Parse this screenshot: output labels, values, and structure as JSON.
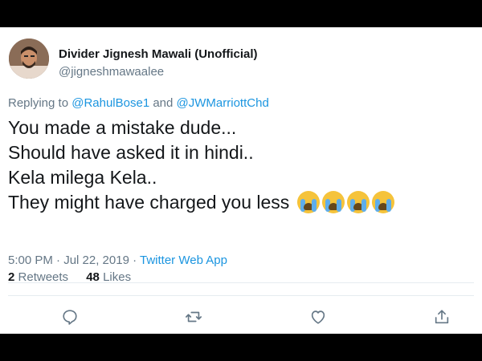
{
  "tweet": {
    "display_name": "Divider Jignesh Mawali (Unofficial)",
    "handle": "@jigneshmawaalee",
    "replying_prefix": "Replying to",
    "reply_to_1": "@RahulBose1",
    "reply_and": "and",
    "reply_to_2": "@JWMarriottChd",
    "lines": [
      "You made a mistake dude...",
      "Should have asked it in hindi..",
      "Kela milega Kela..",
      "They might have charged you less"
    ],
    "emoji_name": "loudly-crying-face",
    "emoji_count": 4,
    "timestamp": "5:00 PM · Jul 22, 2019 ·",
    "source": "Twitter Web App",
    "retweets_count": "2",
    "retweets_label": "Retweets",
    "likes_count": "48",
    "likes_label": "Likes"
  },
  "actions": [
    {
      "name": "reply-icon"
    },
    {
      "name": "retweet-icon"
    },
    {
      "name": "like-icon"
    },
    {
      "name": "share-icon"
    }
  ],
  "colors": {
    "link": "#1b95e0",
    "muted": "#657786",
    "text": "#14171a",
    "frame": "#000000"
  }
}
